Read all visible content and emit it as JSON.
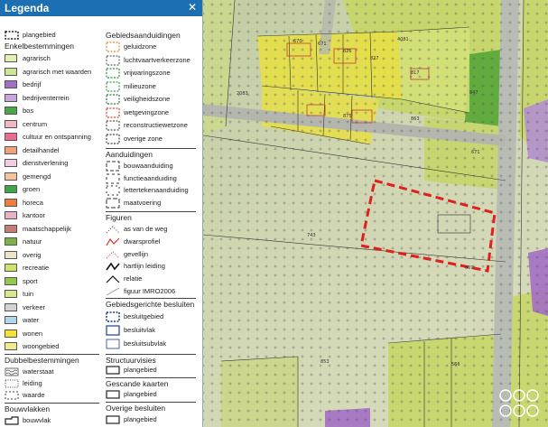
{
  "legend": {
    "title": "Legenda",
    "close_symbol": "✕",
    "top_item": "plangebied",
    "enkel_header": "Enkelbestemmingen",
    "enkel": [
      {
        "label": "agrarisch",
        "color": "#e3f0b4"
      },
      {
        "label": "agrarisch met waarden",
        "color": "#cde596"
      },
      {
        "label": "bedrijf",
        "color": "#a36fc4"
      },
      {
        "label": "bedrijventerrein",
        "color": "#c9a6dd"
      },
      {
        "label": "bos",
        "color": "#4aa748"
      },
      {
        "label": "centrum",
        "color": "#f4b6c4"
      },
      {
        "label": "cultuur en ontspanning",
        "color": "#ee6b91"
      },
      {
        "label": "detailhandel",
        "color": "#f4a07d"
      },
      {
        "label": "dienstverlening",
        "color": "#f4cde5"
      },
      {
        "label": "gemengd",
        "color": "#f4c49d"
      },
      {
        "label": "groen",
        "color": "#3fa64a"
      },
      {
        "label": "horeca",
        "color": "#f07d3b"
      },
      {
        "label": "kantoor",
        "color": "#e6b4c7"
      },
      {
        "label": "maatschappelijk",
        "color": "#c97b78"
      },
      {
        "label": "natuur",
        "color": "#7bb24c"
      },
      {
        "label": "overig",
        "color": "#ede3c9"
      },
      {
        "label": "recreatie",
        "color": "#cde36c"
      },
      {
        "label": "sport",
        "color": "#93c94f"
      },
      {
        "label": "tuin",
        "color": "#d6ea8c"
      },
      {
        "label": "verkeer",
        "color": "#d3d3d3"
      },
      {
        "label": "water",
        "color": "#b1d5ed"
      },
      {
        "label": "wonen",
        "color": "#f4e23b"
      },
      {
        "label": "woongebied",
        "color": "#f4e98f"
      }
    ],
    "dubbel_header": "Dubbelbestemmingen",
    "dubbel": [
      "waterstaat",
      "leiding",
      "waarde"
    ],
    "bouwvlak_header": "Bouwvlakken",
    "bouwvlak": "bouwvlak",
    "gebied_header": "Gebiedsaanduidingen",
    "gebied": [
      {
        "label": "geluidzone",
        "color": "#e58a2b"
      },
      {
        "label": "luchtvaartverkeerzone",
        "color": "#666666"
      },
      {
        "label": "vrijwaringszone",
        "color": "#2a8f3a"
      },
      {
        "label": "milieuzone",
        "color": "#3aa04a"
      },
      {
        "label": "veiligheidszone",
        "color": "#2e7a3a"
      },
      {
        "label": "wetgevingzone",
        "color": "#d8452c"
      },
      {
        "label": "reconstructiewetzone",
        "color": "#555555"
      },
      {
        "label": "overige zone",
        "color": "#444444"
      }
    ],
    "aand_header": "Aanduidingen",
    "aand": [
      "bouwaanduiding",
      "functieaanduiding",
      "lettertekenaanduiding",
      "maatvoering"
    ],
    "fig_header": "Figuren",
    "fig": [
      "as van de weg",
      "dwarsprofiel",
      "gevellijn",
      "hartlijn leiding",
      "relatie",
      "figuur IMRO2006"
    ],
    "besl_header": "Gebiedsgerichte besluiten",
    "besl": [
      "besluitgebied",
      "besluitvlak",
      "besluitsubvlak"
    ],
    "struct_header": "Structuurvisies",
    "struct": "plangebied",
    "gescand_header": "Gescande kaarten",
    "gescand": "plangebied",
    "overige_header": "Overige besluiten",
    "overige": "plangebied"
  },
  "map": {
    "parcel_numbers": [
      "670",
      "671",
      "826",
      "827",
      "4081",
      "2083",
      "875",
      "817",
      "847",
      "863",
      "671",
      "743",
      "669",
      "853",
      "566"
    ],
    "colors": {
      "agrarisch": "#c9dd70",
      "wonen": "#e8df45",
      "bos": "#58a83a",
      "verkeer": "#b7b9b2",
      "plangebied": "#e02020",
      "grid": "#555555"
    }
  }
}
